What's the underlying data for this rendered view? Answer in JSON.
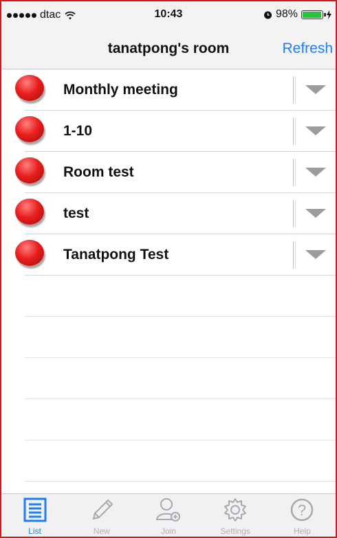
{
  "status_bar": {
    "carrier": "dtac",
    "time": "10:43",
    "battery": "98%",
    "battery_level": 0.98
  },
  "nav": {
    "title": "tanatpong's room",
    "refresh_label": "Refresh"
  },
  "rooms": [
    {
      "name": "Monthly meeting"
    },
    {
      "name": "1-10"
    },
    {
      "name": "Room test"
    },
    {
      "name": "test"
    },
    {
      "name": "Tanatpong Test"
    }
  ],
  "tabs": [
    {
      "label": "List",
      "icon": "list-icon",
      "active": true
    },
    {
      "label": "New",
      "icon": "pencil-icon",
      "active": false
    },
    {
      "label": "Join",
      "icon": "join-user-icon",
      "active": false
    },
    {
      "label": "Settings",
      "icon": "gear-icon",
      "active": false
    },
    {
      "label": "Help",
      "icon": "help-icon",
      "active": false
    }
  ],
  "colors": {
    "accent": "#1d7ef5",
    "status_red": "#ea1f1f",
    "frame_border": "#d9141b"
  }
}
